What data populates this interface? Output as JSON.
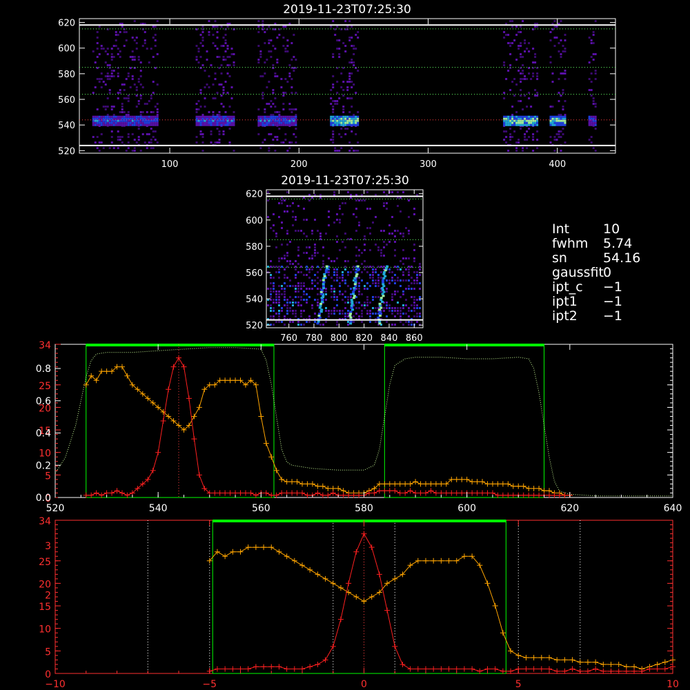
{
  "info_panel": {
    "rows": [
      {
        "key": "Int",
        "value": "10"
      },
      {
        "key": "fwhm",
        "value": "5.74"
      },
      {
        "key": "sn",
        "value": "54.16"
      },
      {
        "key": "gaussfit",
        "value": "0"
      },
      {
        "key": "ipt_c",
        "value": "−1"
      },
      {
        "key": "ipt1",
        "value": "−1"
      },
      {
        "key": "ipt2",
        "value": "−1"
      }
    ]
  },
  "colors": {
    "background": "#000000",
    "axis": "#ffffff",
    "green": "#00ff00",
    "orange": "#ffa500",
    "red": "#ff2020",
    "axis_red": "#ff3030",
    "dotted_green": "#ccff99",
    "dotted_white": "#ffffff"
  },
  "chart_data": [
    {
      "id": "top",
      "type": "heatmap",
      "title": "2019-11-23T07:25:30",
      "xlim": [
        30,
        445
      ],
      "ylim": [
        518,
        623
      ],
      "xticks": [
        100,
        200,
        300,
        400
      ],
      "yticks": [
        520,
        540,
        560,
        580,
        600,
        620
      ],
      "row_line_y": 544,
      "grid_y": [
        564,
        585,
        615
      ],
      "white_h_lines": [
        524,
        618
      ],
      "segments": [
        [
          40,
          90
        ],
        [
          120,
          150
        ],
        [
          168,
          198
        ],
        [
          224,
          246
        ],
        [
          358,
          384
        ],
        [
          394,
          406
        ],
        [
          424,
          430
        ]
      ],
      "bright_segments": [
        [
          228,
          245
        ],
        [
          360,
          382
        ],
        [
          396,
          404
        ]
      ]
    },
    {
      "id": "middle",
      "type": "heatmap",
      "title": "2019-11-23T07:25:30",
      "xlim": [
        742,
        867
      ],
      "ylim": [
        518,
        623
      ],
      "xticks": [
        760,
        780,
        800,
        820,
        840,
        860
      ],
      "yticks": [
        520,
        540,
        560,
        580,
        600,
        620
      ],
      "grid_y": [
        564,
        585,
        616
      ],
      "white_h_lines": [
        524,
        618
      ],
      "bright_columns": [
        785,
        810,
        833
      ]
    },
    {
      "id": "spectrum",
      "type": "line",
      "xlim": [
        520,
        640
      ],
      "xticks": [
        520,
        540,
        560,
        580,
        600,
        620,
        640
      ],
      "y_left_red_ticks": [
        0,
        5,
        10,
        15,
        20,
        25,
        34
      ],
      "y_left_red_labels": [
        "0",
        "5",
        "10",
        "15",
        "20",
        "25",
        "34"
      ],
      "y_left_white_ticks": [
        0.0,
        0.2,
        0.4,
        0.6,
        0.8
      ],
      "y_left_white_labels": [
        "0.0",
        "0.2",
        "0.4",
        "0.6",
        "0.8"
      ],
      "y_right_ticks": [
        0,
        5,
        10,
        15,
        20,
        25,
        34
      ],
      "yr_range": [
        0,
        34
      ],
      "transmission_range": [
        0,
        0.95
      ],
      "center_line_x": 544,
      "green_boxes": [
        [
          526,
          562.5
        ],
        [
          584,
          615
        ]
      ],
      "series": [
        {
          "color": "orange",
          "x": [
            526,
            527,
            528,
            529,
            530,
            531,
            532,
            533,
            534,
            535,
            536,
            537,
            538,
            539,
            540,
            541,
            542,
            543,
            544,
            545,
            546,
            547,
            548,
            549,
            550,
            551,
            552,
            553,
            554,
            555,
            556,
            557,
            558,
            559,
            560,
            561,
            562,
            563,
            564,
            565,
            566,
            567,
            568,
            569,
            570,
            571,
            572,
            573,
            574,
            575,
            576,
            577,
            578,
            579,
            580,
            581,
            582,
            583,
            584,
            585,
            586,
            587,
            588,
            589,
            590,
            591,
            592,
            593,
            594,
            595,
            596,
            597,
            598,
            599,
            600,
            601,
            602,
            603,
            604,
            605,
            606,
            607,
            608,
            609,
            610,
            611,
            612,
            613,
            614,
            615,
            616,
            617,
            618,
            619,
            620
          ],
          "y": [
            25,
            27,
            26,
            28,
            28,
            28,
            29,
            29,
            27,
            25,
            24,
            23,
            22,
            21,
            20,
            19,
            18,
            17,
            16,
            15,
            16,
            18,
            20,
            24,
            25,
            25,
            26,
            26,
            26,
            26,
            26,
            25,
            26,
            25,
            18,
            12,
            9,
            6,
            4,
            3.5,
            3.5,
            3.5,
            3,
            3,
            3,
            2.5,
            2.5,
            2,
            2,
            2,
            1.5,
            1,
            1,
            1,
            1,
            1.5,
            2,
            3,
            3,
            3,
            3,
            3,
            3,
            3,
            3.5,
            3,
            3,
            3,
            3,
            3,
            3,
            4,
            4,
            4,
            4,
            3.5,
            3.5,
            3.5,
            3,
            3,
            3,
            3,
            3,
            2.5,
            2.5,
            2.5,
            2,
            2,
            2,
            1.5,
            1.5,
            1,
            1,
            0.5,
            0.5
          ]
        },
        {
          "color": "red",
          "x": [
            526,
            527,
            528,
            529,
            530,
            531,
            532,
            533,
            534,
            535,
            536,
            537,
            538,
            539,
            540,
            541,
            542,
            543,
            544,
            545,
            546,
            547,
            548,
            549,
            550,
            551,
            552,
            553,
            554,
            555,
            556,
            557,
            558,
            559,
            560,
            561,
            562,
            563,
            564,
            565,
            566,
            567,
            568,
            569,
            570,
            571,
            572,
            573,
            574,
            575,
            576,
            577,
            578,
            579,
            580,
            581,
            582,
            583,
            584,
            585,
            586,
            587,
            588,
            589,
            590,
            591,
            592,
            593,
            594,
            595,
            596,
            597,
            598,
            599,
            600,
            601,
            602,
            603,
            604,
            605,
            606,
            607,
            608,
            609,
            610,
            611,
            612,
            613,
            614,
            615,
            616,
            617,
            618,
            619,
            620
          ],
          "y": [
            0.5,
            0.5,
            1,
            0.5,
            1,
            1,
            1.5,
            1,
            0.5,
            1,
            2,
            3,
            4,
            6,
            10,
            17,
            24,
            29,
            31,
            29,
            22,
            13,
            5,
            2,
            1,
            1,
            1,
            1,
            1,
            1,
            1,
            1,
            1,
            0.5,
            1,
            1,
            0.5,
            0.5,
            1,
            1,
            1,
            1,
            1,
            0.5,
            0.5,
            1,
            0.5,
            0.5,
            1,
            0.5,
            0.5,
            0.5,
            0.5,
            0.5,
            0.5,
            1,
            1,
            1.5,
            1.5,
            1.5,
            1.5,
            1,
            1,
            1.5,
            1,
            1,
            1,
            1.5,
            1,
            1,
            1,
            1,
            1,
            1,
            1,
            1,
            1,
            1,
            1,
            1,
            0.5,
            0.5,
            0.5,
            0.5,
            0.5,
            0.5,
            0.5,
            0.5,
            0.5,
            0.5,
            0.5,
            0.5,
            0.5,
            0.5,
            0.5
          ]
        },
        {
          "color": "dotted_green",
          "axis": "left_white",
          "x": [
            520,
            522,
            524,
            525,
            526,
            527,
            528,
            530,
            532,
            535,
            540,
            545,
            550,
            555,
            560,
            561,
            562,
            563,
            564,
            565,
            566,
            568,
            570,
            575,
            580,
            582,
            583,
            584,
            585,
            586,
            588,
            590,
            595,
            600,
            605,
            610,
            612,
            613,
            614,
            615,
            616,
            617,
            618,
            620,
            625,
            630,
            640
          ],
          "y": [
            0.15,
            0.25,
            0.45,
            0.6,
            0.75,
            0.85,
            0.89,
            0.9,
            0.9,
            0.9,
            0.91,
            0.92,
            0.93,
            0.93,
            0.92,
            0.85,
            0.7,
            0.5,
            0.3,
            0.22,
            0.2,
            0.19,
            0.18,
            0.17,
            0.17,
            0.2,
            0.3,
            0.5,
            0.7,
            0.82,
            0.86,
            0.87,
            0.87,
            0.86,
            0.86,
            0.87,
            0.86,
            0.8,
            0.65,
            0.45,
            0.25,
            0.1,
            0.04,
            0.02,
            0.01,
            0.01,
            0.01
          ]
        }
      ]
    },
    {
      "id": "zoom",
      "type": "line",
      "xlim": [
        -10,
        10
      ],
      "xticks": [
        -10,
        -5,
        0,
        5,
        10
      ],
      "y_left_ticks": [
        0,
        5,
        10,
        15,
        20,
        25,
        34
      ],
      "y_left_labels": [
        "0",
        "5",
        "10",
        "15",
        "20",
        "25",
        "34"
      ],
      "y_right_ticks": [
        0,
        5,
        10,
        15,
        20,
        25,
        34
      ],
      "yr_range": [
        0,
        34
      ],
      "overlay_labels": [
        {
          "at": 17.5,
          "text": "2"
        },
        {
          "at": 28.5,
          "text": "3"
        }
      ],
      "center_line_x": 0,
      "white_dotted_x": [
        -7,
        -5,
        -1,
        1,
        5,
        7
      ],
      "green_box": [
        -4.9,
        4.6
      ],
      "series": [
        {
          "color": "orange",
          "x": [
            -5,
            -4.75,
            -4.5,
            -4.25,
            -4,
            -3.75,
            -3.5,
            -3.25,
            -3,
            -2.75,
            -2.5,
            -2.25,
            -2,
            -1.75,
            -1.5,
            -1.25,
            -1,
            -0.75,
            -0.5,
            -0.25,
            0,
            0.25,
            0.5,
            0.75,
            1,
            1.25,
            1.5,
            1.75,
            2,
            2.25,
            2.5,
            2.75,
            3,
            3.25,
            3.5,
            3.75,
            4,
            4.25,
            4.5,
            4.75,
            5,
            5.25,
            5.5,
            5.75,
            6,
            6.25,
            6.5,
            6.75,
            7,
            7.25,
            7.5,
            7.75,
            8,
            8.25,
            8.5,
            8.75,
            9,
            9.25,
            9.5,
            9.75,
            10
          ],
          "y": [
            25,
            27,
            26,
            27,
            27,
            28,
            28,
            28,
            28,
            27,
            26,
            25,
            24,
            23,
            22,
            21,
            20,
            19,
            18,
            17,
            16,
            17,
            18,
            20,
            21,
            22,
            24,
            25,
            25,
            25,
            25,
            25,
            25,
            26,
            26,
            24,
            20,
            15,
            9,
            5,
            4,
            3.5,
            3.5,
            3.5,
            3.5,
            3,
            3,
            3,
            2.5,
            2.5,
            2.5,
            2,
            2,
            2,
            1.5,
            1.5,
            1,
            1.5,
            2,
            2.5,
            3
          ]
        },
        {
          "color": "red",
          "x": [
            -5,
            -4.75,
            -4.5,
            -4.25,
            -4,
            -3.75,
            -3.5,
            -3.25,
            -3,
            -2.75,
            -2.5,
            -2.25,
            -2,
            -1.75,
            -1.5,
            -1.25,
            -1,
            -0.75,
            -0.5,
            -0.25,
            0,
            0.25,
            0.5,
            0.75,
            1,
            1.25,
            1.5,
            1.75,
            2,
            2.25,
            2.5,
            2.75,
            3,
            3.25,
            3.5,
            3.75,
            4,
            4.25,
            4.5,
            4.75,
            5,
            5.25,
            5.5,
            5.75,
            6,
            6.25,
            6.5,
            6.75,
            7,
            7.25,
            7.5,
            7.75,
            8,
            8.25,
            8.5,
            8.75,
            9,
            9.25,
            9.5,
            9.75,
            10
          ],
          "y": [
            0.5,
            1,
            1,
            1,
            1,
            1,
            1.5,
            1.5,
            1.5,
            1.5,
            1,
            1,
            1,
            1.5,
            2,
            3,
            6,
            12,
            20,
            27,
            31,
            28,
            22,
            14,
            6,
            2,
            1,
            1,
            1,
            1,
            1,
            1,
            1,
            1,
            1,
            0.5,
            1,
            1,
            0.5,
            0.5,
            1,
            1,
            1,
            1,
            1,
            0.5,
            0.5,
            1,
            0.5,
            0.5,
            1,
            0.5,
            0.5,
            0.5,
            0.5,
            0.5,
            0.5,
            1,
            1,
            1,
            1.5
          ]
        }
      ]
    }
  ]
}
